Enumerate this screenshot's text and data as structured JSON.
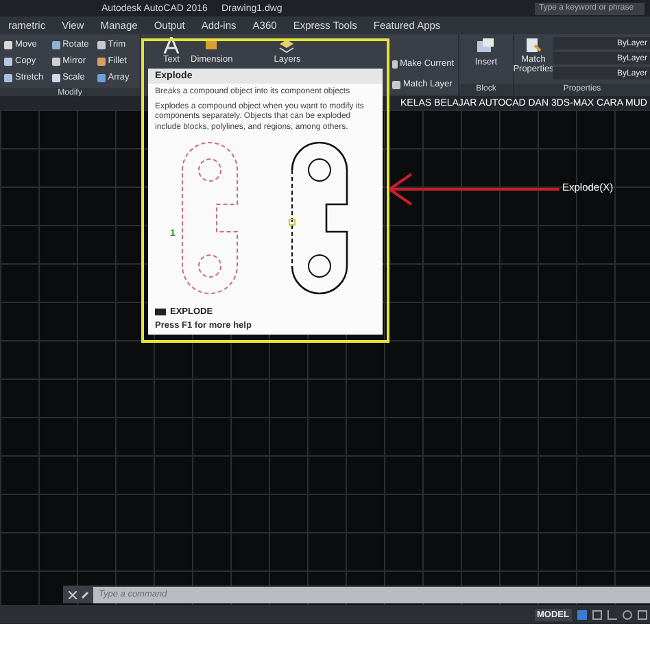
{
  "title_bar": {
    "app": "Autodesk AutoCAD 2016",
    "file": "Drawing1.dwg",
    "search": {
      "placeholder": "Type a keyword or phrase"
    }
  },
  "tabs": [
    {
      "label": "rametric",
      "selected": false
    },
    {
      "label": "View",
      "selected": false
    },
    {
      "label": "Manage",
      "selected": false
    },
    {
      "label": "Output",
      "selected": false
    },
    {
      "label": "Add-ins",
      "selected": false
    },
    {
      "label": "A360",
      "selected": false
    },
    {
      "label": "Express Tools",
      "selected": false
    },
    {
      "label": "Featured Apps",
      "selected": false
    }
  ],
  "ribbon": {
    "modify": {
      "label": "Modify",
      "tools": [
        "Move",
        "Rotate",
        "Trim",
        "Copy",
        "Mirror",
        "Fillet",
        "Stretch",
        "Scale",
        "Array"
      ]
    },
    "annotation": [
      "Text",
      "Dimension"
    ],
    "layers": {
      "label": "Layers",
      "tools": [
        "Make Current",
        "Match Layer"
      ]
    },
    "block": {
      "tool": "Insert",
      "label": "Block"
    },
    "properties": {
      "tool": "Match Properties",
      "rows": [
        "ByLayer",
        "ByLayer",
        "ByLayer"
      ],
      "label": "Properties"
    }
  },
  "banner": "KELAS BELAJAR AUTOCAD DAN 3DS-MAX CARA MUD",
  "tooltip": {
    "title": "Explode",
    "summary": "Breaks a compound object into its component objects",
    "detail": "Explodes a compound object when you want to modify its components separately. Objects that can be exploded include blocks, polylines, and regions, among others.",
    "step": "1",
    "command": "EXPLODE",
    "help": "Press F1 for more help"
  },
  "callout": {
    "label": "Explode(X)"
  },
  "command_line": {
    "placeholder": "Type a command"
  },
  "status_bar": {
    "model": "MODEL"
  }
}
